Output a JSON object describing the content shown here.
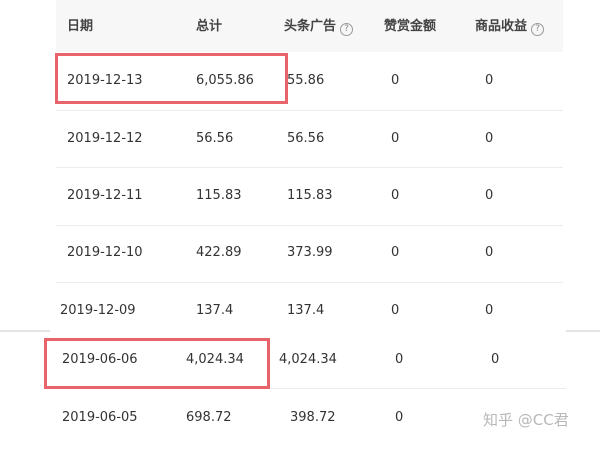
{
  "table": {
    "headers": {
      "date": "日期",
      "total": "总计",
      "toutiao_ads": "头条广告",
      "tips": "赞赏金额",
      "goods": "商品收益"
    },
    "rows_top": [
      {
        "date": "2019-12-13",
        "total": "6,055.86",
        "ads": "55.86",
        "tips": "0",
        "goods": "0"
      },
      {
        "date": "2019-12-12",
        "total": "56.56",
        "ads": "56.56",
        "tips": "0",
        "goods": "0"
      },
      {
        "date": "2019-12-11",
        "total": "115.83",
        "ads": "115.83",
        "tips": "0",
        "goods": "0"
      },
      {
        "date": "2019-12-10",
        "total": "422.89",
        "ads": "373.99",
        "tips": "0",
        "goods": "0"
      },
      {
        "date": "2019-12-09",
        "total": "137.4",
        "ads": "137.4",
        "tips": "0",
        "goods": "0"
      }
    ],
    "rows_bottom": [
      {
        "date": "2019-06-06",
        "total": "4,024.34",
        "ads": "4,024.34",
        "tips": "0",
        "goods": "0"
      },
      {
        "date": "2019-06-05",
        "total": "698.72",
        "ads": "398.72",
        "tips": "0",
        "goods": "0"
      }
    ]
  },
  "watermark": "知乎 @CC君",
  "colors": {
    "highlight": "#e8646a",
    "header_bg": "#f7f7f7",
    "text": "#333333"
  }
}
